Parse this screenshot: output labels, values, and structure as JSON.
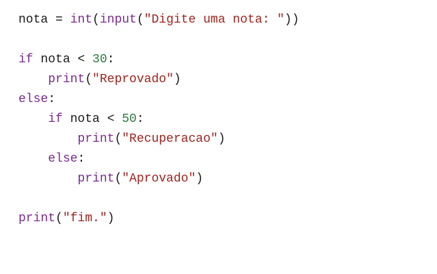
{
  "editor": {
    "lines": [
      {
        "indent": "",
        "tokens": [
          {
            "text": "nota",
            "kind": "name"
          },
          {
            "text": " = ",
            "kind": "op"
          },
          {
            "text": "int",
            "kind": "fn"
          },
          {
            "text": "(",
            "kind": "op"
          },
          {
            "text": "input",
            "kind": "fn"
          },
          {
            "text": "(",
            "kind": "op"
          },
          {
            "text": "\"Digite uma nota: \"",
            "kind": "str"
          },
          {
            "text": "))",
            "kind": "op"
          }
        ]
      },
      {
        "indent": "",
        "tokens": []
      },
      {
        "indent": "",
        "tokens": [
          {
            "text": "if",
            "kind": "kw"
          },
          {
            "text": " nota < ",
            "kind": "op"
          },
          {
            "text": "30",
            "kind": "num"
          },
          {
            "text": ":",
            "kind": "op"
          }
        ]
      },
      {
        "indent": "    ",
        "tokens": [
          {
            "text": "print",
            "kind": "fn"
          },
          {
            "text": "(",
            "kind": "op"
          },
          {
            "text": "\"Reprovado\"",
            "kind": "str"
          },
          {
            "text": ")",
            "kind": "op"
          }
        ]
      },
      {
        "indent": "",
        "tokens": [
          {
            "text": "else",
            "kind": "kw"
          },
          {
            "text": ":",
            "kind": "op"
          }
        ]
      },
      {
        "indent": "    ",
        "tokens": [
          {
            "text": "if",
            "kind": "kw"
          },
          {
            "text": " nota < ",
            "kind": "op"
          },
          {
            "text": "50",
            "kind": "num"
          },
          {
            "text": ":",
            "kind": "op"
          }
        ]
      },
      {
        "indent": "        ",
        "tokens": [
          {
            "text": "print",
            "kind": "fn"
          },
          {
            "text": "(",
            "kind": "op"
          },
          {
            "text": "\"Recuperacao\"",
            "kind": "str"
          },
          {
            "text": ")",
            "kind": "op"
          }
        ]
      },
      {
        "indent": "    ",
        "tokens": [
          {
            "text": "else",
            "kind": "kw"
          },
          {
            "text": ":",
            "kind": "op"
          }
        ]
      },
      {
        "indent": "        ",
        "tokens": [
          {
            "text": "print",
            "kind": "fn"
          },
          {
            "text": "(",
            "kind": "op"
          },
          {
            "text": "\"Aprovado\"",
            "kind": "str"
          },
          {
            "text": ")",
            "kind": "op"
          }
        ]
      },
      {
        "indent": "",
        "tokens": []
      },
      {
        "indent": "",
        "tokens": [
          {
            "text": "print",
            "kind": "fn"
          },
          {
            "text": "(",
            "kind": "op"
          },
          {
            "text": "\"fim.\"",
            "kind": "str"
          },
          {
            "text": ")",
            "kind": "op"
          }
        ]
      }
    ]
  },
  "colors": {
    "background": "#ffffff",
    "keyword": "#7a2a8f",
    "builtin": "#7a2a8f",
    "string": "#a0231e",
    "number": "#2c7a3f",
    "plain": "#1a1a1a"
  }
}
